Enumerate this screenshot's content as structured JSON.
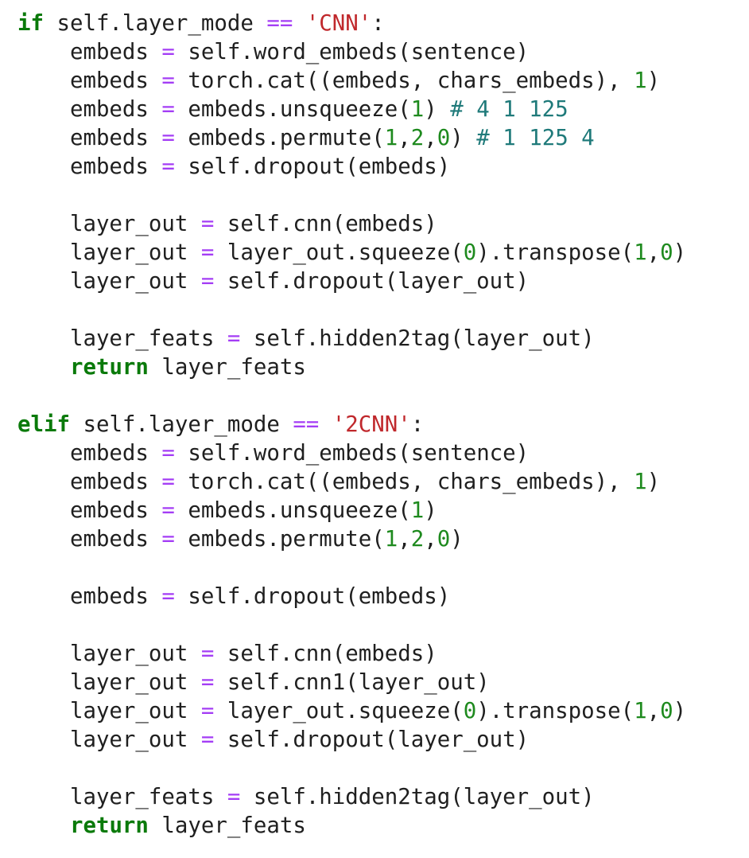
{
  "editor": {
    "lines": [
      [
        {
          "t": "kw",
          "v": "if"
        },
        {
          "t": "plain",
          "v": " self.layer_mode "
        },
        {
          "t": "op",
          "v": "=="
        },
        {
          "t": "plain",
          "v": " "
        },
        {
          "t": "str",
          "v": "'CNN'"
        },
        {
          "t": "plain",
          "v": ":"
        }
      ],
      [
        {
          "t": "plain",
          "v": "    embeds "
        },
        {
          "t": "op",
          "v": "="
        },
        {
          "t": "plain",
          "v": " self.word_embeds(sentence)"
        }
      ],
      [
        {
          "t": "plain",
          "v": "    embeds "
        },
        {
          "t": "op",
          "v": "="
        },
        {
          "t": "plain",
          "v": " torch.cat((embeds, chars_embeds), "
        },
        {
          "t": "num",
          "v": "1"
        },
        {
          "t": "plain",
          "v": ")"
        }
      ],
      [
        {
          "t": "plain",
          "v": "    embeds "
        },
        {
          "t": "op",
          "v": "="
        },
        {
          "t": "plain",
          "v": " embeds.unsqueeze("
        },
        {
          "t": "num",
          "v": "1"
        },
        {
          "t": "plain",
          "v": ") "
        },
        {
          "t": "cm",
          "v": "# 4 1 125"
        }
      ],
      [
        {
          "t": "plain",
          "v": "    embeds "
        },
        {
          "t": "op",
          "v": "="
        },
        {
          "t": "plain",
          "v": " embeds.permute("
        },
        {
          "t": "num",
          "v": "1"
        },
        {
          "t": "plain",
          "v": ","
        },
        {
          "t": "num",
          "v": "2"
        },
        {
          "t": "plain",
          "v": ","
        },
        {
          "t": "num",
          "v": "0"
        },
        {
          "t": "plain",
          "v": ") "
        },
        {
          "t": "cm",
          "v": "# 1 125 4"
        }
      ],
      [
        {
          "t": "plain",
          "v": "    embeds "
        },
        {
          "t": "op",
          "v": "="
        },
        {
          "t": "plain",
          "v": " self.dropout(embeds)"
        }
      ],
      [],
      [
        {
          "t": "plain",
          "v": "    layer_out "
        },
        {
          "t": "op",
          "v": "="
        },
        {
          "t": "plain",
          "v": " self.cnn(embeds)"
        }
      ],
      [
        {
          "t": "plain",
          "v": "    layer_out "
        },
        {
          "t": "op",
          "v": "="
        },
        {
          "t": "plain",
          "v": " layer_out.squeeze("
        },
        {
          "t": "num",
          "v": "0"
        },
        {
          "t": "plain",
          "v": ").transpose("
        },
        {
          "t": "num",
          "v": "1"
        },
        {
          "t": "plain",
          "v": ","
        },
        {
          "t": "num",
          "v": "0"
        },
        {
          "t": "plain",
          "v": ")"
        }
      ],
      [
        {
          "t": "plain",
          "v": "    layer_out "
        },
        {
          "t": "op",
          "v": "="
        },
        {
          "t": "plain",
          "v": " self.dropout(layer_out)"
        }
      ],
      [],
      [
        {
          "t": "plain",
          "v": "    layer_feats "
        },
        {
          "t": "op",
          "v": "="
        },
        {
          "t": "plain",
          "v": " self.hidden2tag(layer_out)"
        }
      ],
      [
        {
          "t": "plain",
          "v": "    "
        },
        {
          "t": "kw",
          "v": "return"
        },
        {
          "t": "plain",
          "v": " layer_feats"
        }
      ],
      [],
      [
        {
          "t": "kw",
          "v": "elif"
        },
        {
          "t": "plain",
          "v": " self.layer_mode "
        },
        {
          "t": "op",
          "v": "=="
        },
        {
          "t": "plain",
          "v": " "
        },
        {
          "t": "str",
          "v": "'2CNN'"
        },
        {
          "t": "plain",
          "v": ":"
        }
      ],
      [
        {
          "t": "plain",
          "v": "    embeds "
        },
        {
          "t": "op",
          "v": "="
        },
        {
          "t": "plain",
          "v": " self.word_embeds(sentence)"
        }
      ],
      [
        {
          "t": "plain",
          "v": "    embeds "
        },
        {
          "t": "op",
          "v": "="
        },
        {
          "t": "plain",
          "v": " torch.cat((embeds, chars_embeds), "
        },
        {
          "t": "num",
          "v": "1"
        },
        {
          "t": "plain",
          "v": ")"
        }
      ],
      [
        {
          "t": "plain",
          "v": "    embeds "
        },
        {
          "t": "op",
          "v": "="
        },
        {
          "t": "plain",
          "v": " embeds.unsqueeze("
        },
        {
          "t": "num",
          "v": "1"
        },
        {
          "t": "plain",
          "v": ")"
        }
      ],
      [
        {
          "t": "plain",
          "v": "    embeds "
        },
        {
          "t": "op",
          "v": "="
        },
        {
          "t": "plain",
          "v": " embeds.permute("
        },
        {
          "t": "num",
          "v": "1"
        },
        {
          "t": "plain",
          "v": ","
        },
        {
          "t": "num",
          "v": "2"
        },
        {
          "t": "plain",
          "v": ","
        },
        {
          "t": "num",
          "v": "0"
        },
        {
          "t": "plain",
          "v": ")"
        }
      ],
      [],
      [
        {
          "t": "plain",
          "v": "    embeds "
        },
        {
          "t": "op",
          "v": "="
        },
        {
          "t": "plain",
          "v": " self.dropout(embeds)"
        }
      ],
      [],
      [
        {
          "t": "plain",
          "v": "    layer_out "
        },
        {
          "t": "op",
          "v": "="
        },
        {
          "t": "plain",
          "v": " self.cnn(embeds)"
        }
      ],
      [
        {
          "t": "plain",
          "v": "    layer_out "
        },
        {
          "t": "op",
          "v": "="
        },
        {
          "t": "plain",
          "v": " self.cnn1(layer_out)"
        }
      ],
      [
        {
          "t": "plain",
          "v": "    layer_out "
        },
        {
          "t": "op",
          "v": "="
        },
        {
          "t": "plain",
          "v": " layer_out.squeeze("
        },
        {
          "t": "num",
          "v": "0"
        },
        {
          "t": "plain",
          "v": ").transpose("
        },
        {
          "t": "num",
          "v": "1"
        },
        {
          "t": "plain",
          "v": ","
        },
        {
          "t": "num",
          "v": "0"
        },
        {
          "t": "plain",
          "v": ")"
        }
      ],
      [
        {
          "t": "plain",
          "v": "    layer_out "
        },
        {
          "t": "op",
          "v": "="
        },
        {
          "t": "plain",
          "v": " self.dropout(layer_out)"
        }
      ],
      [],
      [
        {
          "t": "plain",
          "v": "    layer_feats "
        },
        {
          "t": "op",
          "v": "="
        },
        {
          "t": "plain",
          "v": " self.hidden2tag(layer_out)"
        }
      ],
      [
        {
          "t": "plain",
          "v": "    "
        },
        {
          "t": "kw",
          "v": "return"
        },
        {
          "t": "plain",
          "v": " layer_feats"
        }
      ]
    ]
  },
  "colors": {
    "background": "#ffffff",
    "keyword": "#0a7a0a",
    "operator": "#a43df5",
    "number": "#1e8a1e",
    "string": "#c0282c",
    "comment": "#1f7a7a",
    "text": "#1f1f1f"
  }
}
